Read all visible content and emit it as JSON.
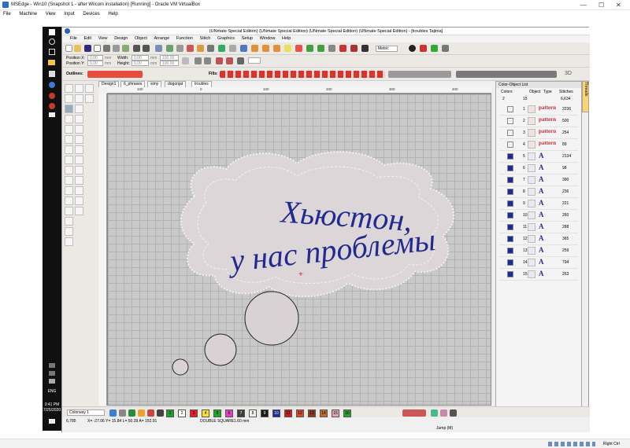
{
  "vbox": {
    "title": "MSEdge - Win10 (Snapshot 1 - after Wilcom installation) [Running] - Oracle VM VirtualBox",
    "menu": [
      "File",
      "Machine",
      "View",
      "Input",
      "Devices",
      "Help"
    ],
    "status_right": "Right Ctrl"
  },
  "app": {
    "title": "(UNmate Special Edition) (UNmate Special Edition) (UNmate Special Edition) (UNmate Special Edition) - [troubles        Tajima]",
    "menu": [
      "File",
      "Edit",
      "View",
      "Design",
      "Object",
      "Arrange",
      "Function",
      "Stitch",
      "Graphics",
      "Setup",
      "Window",
      "Help"
    ],
    "units_select": "Metric",
    "toolbar2": {
      "position_x_label": "Position X:",
      "position_y_label": "Position Y:",
      "width_label": "Width:",
      "height_label": "Height:",
      "position_x": "0.00",
      "position_y": "0.00",
      "width": "0.00",
      "height": "0.00",
      "unit": "mm",
      "pct_w": "100.00",
      "pct_h": "100.00"
    },
    "outlines_label": "Outlines:",
    "fills_label": "Fills:",
    "tabs": [
      "Design1",
      "6_phrases",
      "simy",
      "dogonjat",
      "troubles"
    ],
    "active_tab": "troubles",
    "ruler_top": [
      "100",
      "",
      "",
      "",
      "",
      "0",
      "",
      "",
      "",
      "",
      "100",
      "",
      "",
      "",
      "",
      "200",
      "",
      "",
      "",
      "",
      "300",
      "",
      "",
      "",
      "",
      "400"
    ],
    "canvas_text": {
      "line1": "Хьюстон,",
      "line2": "у нас проблемы"
    },
    "colorway": "Colorway 1",
    "color_buttons": [
      {
        "label": "1",
        "color": "#1e9b2a"
      },
      {
        "label": "2",
        "color": "#ffffff"
      },
      {
        "label": "3",
        "color": "#e41f1f"
      },
      {
        "label": "4",
        "color": "#f7e12a"
      },
      {
        "label": "5",
        "color": "#1fa52b"
      },
      {
        "label": "6",
        "color": "#e63cc3"
      },
      {
        "label": "7",
        "color": "#3d3d3d"
      },
      {
        "label": "8",
        "color": "#f2f2f2"
      },
      {
        "label": "9",
        "color": "#1b1b1b"
      },
      {
        "label": "10",
        "color": "#1c2b9a"
      },
      {
        "label": "11",
        "color": "#c22020"
      },
      {
        "label": "12",
        "color": "#d44a2c"
      },
      {
        "label": "13",
        "color": "#8a3c22"
      },
      {
        "label": "14",
        "color": "#c26a2a"
      },
      {
        "label": "15",
        "color": "#e2a5b8"
      },
      {
        "label": "16",
        "color": "#2f9f34"
      }
    ],
    "status": {
      "coord1": "6,785",
      "coords": "X= -27.06 Y= 15.84 L= 50.39 A= 152.91",
      "stitch_type": "DOUBLE SQUARE",
      "size": "1.60 mm",
      "jump": "Jump (M)"
    },
    "color_object_list": {
      "title": "Color-Object List",
      "header_top": {
        "col1": "2",
        "col2": "15",
        "col3": "6,634"
      },
      "header": {
        "colors": "Colors",
        "object": "Object",
        "type": "Type",
        "stitches": "Stitches"
      },
      "rows": [
        {
          "num": "1",
          "type": "pattern",
          "stitches": "2236",
          "color": "#f2f2f2"
        },
        {
          "num": "2",
          "type": "pattern",
          "stitches": "500",
          "color": "#f2f2f2"
        },
        {
          "num": "3",
          "type": "pattern",
          "stitches": "254",
          "color": "#f2f2f2"
        },
        {
          "num": "4",
          "type": "pattern",
          "stitches": "89",
          "color": "#f2f2f2"
        },
        {
          "num": "5",
          "type": "A",
          "stitches": "2134",
          "color": "#1c2b9a"
        },
        {
          "num": "6",
          "type": "A",
          "stitches": "98",
          "color": "#1c2b9a"
        },
        {
          "num": "7",
          "type": "A",
          "stitches": "390",
          "color": "#1c2b9a"
        },
        {
          "num": "8",
          "type": "A",
          "stitches": "236",
          "color": "#1c2b9a"
        },
        {
          "num": "9",
          "type": "A",
          "stitches": "221",
          "color": "#1c2b9a"
        },
        {
          "num": "10",
          "type": "A",
          "stitches": "260",
          "color": "#1c2b9a"
        },
        {
          "num": "11",
          "type": "A",
          "stitches": "288",
          "color": "#1c2b9a"
        },
        {
          "num": "12",
          "type": "A",
          "stitches": "365",
          "color": "#1c2b9a"
        },
        {
          "num": "13",
          "type": "A",
          "stitches": "259",
          "color": "#1c2b9a"
        },
        {
          "num": "14",
          "type": "A",
          "stitches": "794",
          "color": "#1c2b9a"
        },
        {
          "num": "15",
          "type": "A",
          "stitches": "263",
          "color": "#1c2b9a"
        }
      ]
    },
    "side_tab": "Threads"
  },
  "win_taskbar": {
    "lang": "ENG",
    "time": "3:41 PM",
    "date": "7/25/2020"
  }
}
